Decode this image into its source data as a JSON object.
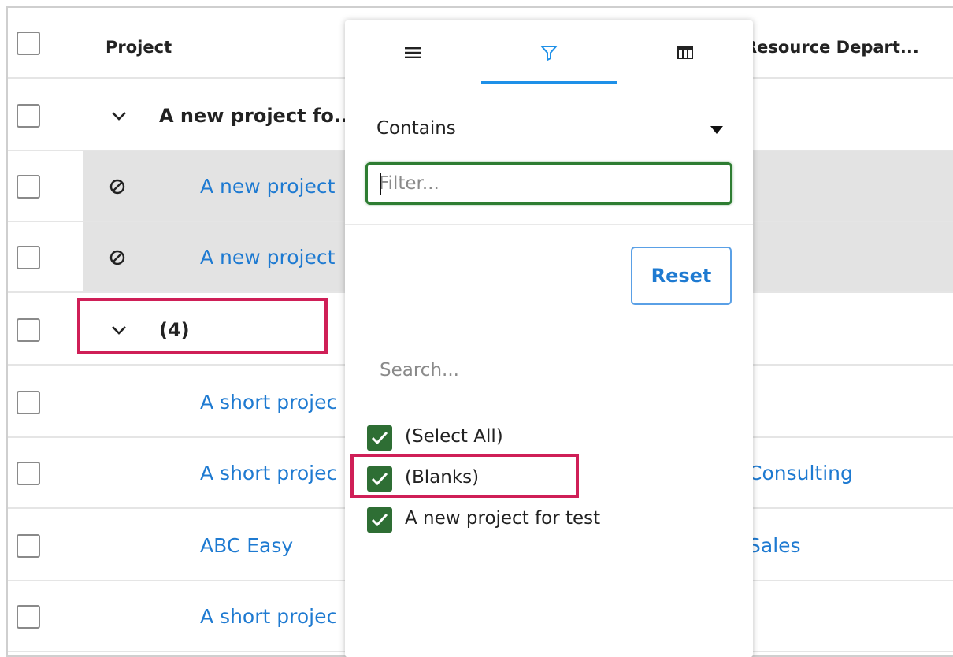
{
  "grid": {
    "header": {
      "project": "Project",
      "resource_department": "Resource Depart..."
    },
    "rows": [
      {
        "type": "group",
        "label": "A new project fo..."
      },
      {
        "type": "child",
        "project": "A new project",
        "resource": "",
        "status_icon": "ban-icon"
      },
      {
        "type": "child",
        "project": "A new project",
        "resource": "",
        "status_icon": "ban-icon"
      },
      {
        "type": "group",
        "label": "(4)"
      },
      {
        "type": "child",
        "project": "A short projec",
        "resource": ""
      },
      {
        "type": "child",
        "project": "A short projec",
        "resource": "Consulting"
      },
      {
        "type": "child",
        "project": "ABC Easy",
        "resource": "Sales"
      },
      {
        "type": "child",
        "project": "A short projec",
        "resource": ""
      }
    ]
  },
  "filter_popup": {
    "tabs": [
      {
        "icon": "menu-icon"
      },
      {
        "icon": "filter-icon",
        "active": true
      },
      {
        "icon": "columns-icon"
      }
    ],
    "operator": "Contains",
    "filter_placeholder": "Filter...",
    "reset_label": "Reset",
    "search_placeholder": "Search...",
    "options": [
      {
        "label": "(Select All)",
        "checked": true
      },
      {
        "label": "(Blanks)",
        "checked": true
      },
      {
        "label": "A new project for test",
        "checked": true
      }
    ]
  },
  "colors": {
    "link": "#1e7ad1",
    "highlight": "#cf1f57",
    "checkbox_checked": "#2e6e34",
    "active_tab": "#1e90e8"
  }
}
